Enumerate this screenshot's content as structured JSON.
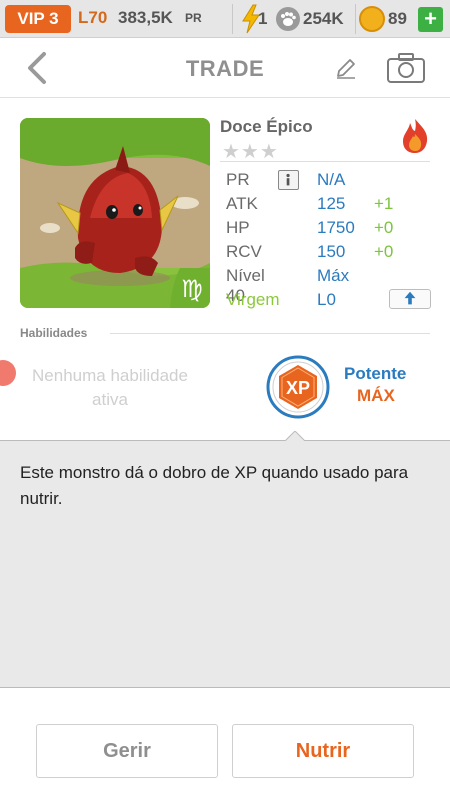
{
  "status_bar": {
    "vip": "VIP 3",
    "level": "L70",
    "pr_value": "383,5K",
    "pr_unit": "PR",
    "energy": "1",
    "food": "254K",
    "gems": "89",
    "plus": "+"
  },
  "header": {
    "title": "TRADE"
  },
  "monster": {
    "name": "Doce Épico",
    "stars": "★★★",
    "element": "fire",
    "sign_symbol": "♍",
    "stats": {
      "pr_label": "PR",
      "pr_value": "N/A",
      "atk_label": "ATK",
      "atk_value": "125",
      "atk_bonus": "+1",
      "hp_label": "HP",
      "hp_value": "1750",
      "hp_bonus": "+0",
      "rcv_label": "RCV",
      "rcv_value": "150",
      "rcv_bonus": "+0",
      "level_label": "Nível 40",
      "level_value": "Máx",
      "sign_label": "Virgem",
      "sign_value": "L0"
    }
  },
  "abilities": {
    "title": "Habilidades",
    "none_text": "Nenhuma habilidade ativa",
    "xp_badge": "XP",
    "potency_label": "Potente",
    "potency_value": "MÁX"
  },
  "description": "Este monstro dá o dobro de XP quando usado para nutrir.",
  "buttons": {
    "manage": "Gerir",
    "feed": "Nutrir"
  },
  "colors": {
    "accent_orange": "#e8651f",
    "stat_blue": "#2b7bbf",
    "bonus_green": "#7cc43d"
  }
}
